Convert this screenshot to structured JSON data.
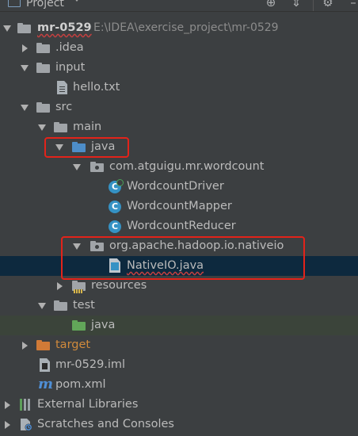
{
  "header": {
    "title": "Project",
    "icons": [
      "locate-icon",
      "collapse-icon",
      "settings-icon"
    ]
  },
  "tree": {
    "root": {
      "name": "mr-0529",
      "path": "E:\\IDEA\\exercise_project\\mr-0529"
    },
    "idea": ".idea",
    "input": "input",
    "hello": "hello.txt",
    "src": "src",
    "main": "main",
    "java": "java",
    "pkg_wordcount": "com.atguigu.mr.wordcount",
    "classes": [
      "WordcountDriver",
      "WordcountMapper",
      "WordcountReducer"
    ],
    "pkg_nativeio": "org.apache.hadoop.io.nativeio",
    "nativeio_file": "NativeIO.java",
    "resources": "resources",
    "test": "test",
    "test_java": "java",
    "target": "target",
    "iml": "mr-0529.iml",
    "pom": "pom.xml",
    "external_libraries": "External Libraries",
    "scratches": "Scratches and Consoles"
  },
  "colors": {
    "background": "#3c3f41",
    "selection_blue": "#0d293e",
    "selection_green": "#3b443a",
    "highlight_red": "#e2231a",
    "folder_blue": "#4d8dc8",
    "folder_green": "#62a659",
    "folder_orange": "#d07a37",
    "class_blue": "#3592c4"
  }
}
